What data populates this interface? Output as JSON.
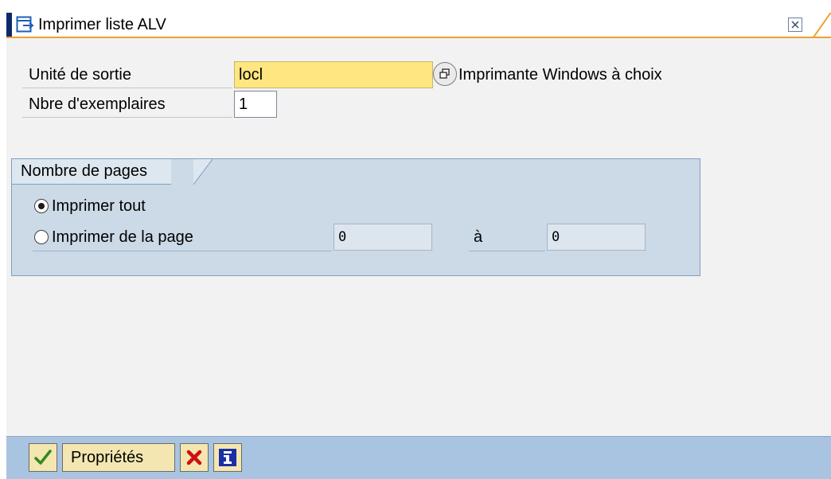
{
  "dialog": {
    "title": "Imprimer liste ALV",
    "icon": "print-dialog-icon",
    "close_icon": "close-icon"
  },
  "output": {
    "label": "Unité de sortie",
    "value": "locl",
    "help_icon": "value-help-icon",
    "description": "Imprimante Windows à choix"
  },
  "copies": {
    "label": "Nbre d'exemplaires",
    "value": "1"
  },
  "pages": {
    "group_title": "Nombre de pages",
    "print_all": {
      "label": "Imprimer tout",
      "selected": true
    },
    "print_range": {
      "label": "Imprimer de la page",
      "selected": false
    },
    "from_value": "0",
    "to_label": "à",
    "to_value": "0"
  },
  "toolbar": {
    "confirm_icon": "checkmark-icon",
    "properties_label": "Propriétés",
    "cancel_icon": "cancel-x-icon",
    "info_icon": "info-icon"
  },
  "colors": {
    "toolbar_bg": "#a8c4e0",
    "group_bg": "#cbdae6",
    "required_input": "#ffe680",
    "title_accent": "#f0a030",
    "cancel_red": "#d01010",
    "info_blue": "#1a2ea8",
    "confirm_green": "#2f8a1e"
  }
}
